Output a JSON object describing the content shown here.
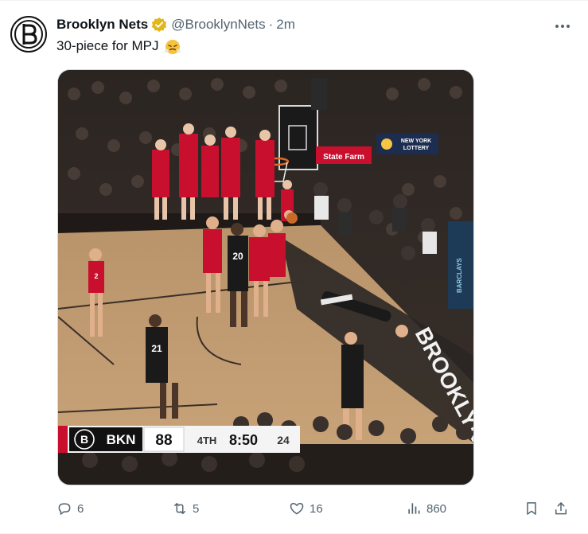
{
  "tweet": {
    "author_name": "Brooklyn Nets",
    "handle": "@BrooklynNets",
    "separator": "·",
    "time": "2m",
    "text": "30-piece for MPJ",
    "emoji": "😤"
  },
  "media": {
    "scorebug": {
      "team": "BKN",
      "score": "88",
      "quarter": "4TH",
      "clock": "8:50",
      "shot_clock": "24"
    },
    "signage": {
      "statefarm": "State Farm",
      "lottery_line1": "NEW YORK",
      "lottery_line2": "LOTTERY",
      "court_text": "BROOKLYN",
      "barclays": "BARCLAYS"
    },
    "jerseys": {
      "player_a": "20",
      "player_b": "21",
      "player_c": "2"
    }
  },
  "actions": {
    "replies": "6",
    "reposts": "5",
    "likes": "16",
    "views": "860"
  },
  "colors": {
    "accent_gold": "#e2b719",
    "text_secondary": "#536471",
    "hawks_red": "#c8102e"
  },
  "icons": {
    "reply": "reply-icon",
    "repost": "repost-icon",
    "like": "heart-icon",
    "views": "views-icon",
    "bookmark": "bookmark-icon",
    "share": "share-icon",
    "more": "more-icon",
    "verified": "verified-badge-icon"
  }
}
